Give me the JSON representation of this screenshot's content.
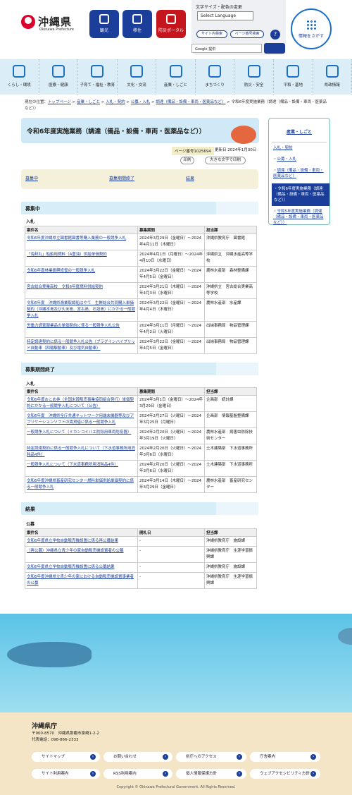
{
  "header": {
    "pref_name": "沖縄県",
    "pref_en": "Okinawa Prefecture",
    "tiles": [
      {
        "label": "観光",
        "color": "#1a3e9a"
      },
      {
        "label": "移住",
        "color": "#1a3e9a"
      },
      {
        "label": "防災ポータル",
        "color": "#c4161c"
      }
    ],
    "text_settings": "文字サイズ・配色の変更",
    "language": "Select Language",
    "site_search": "サイト内検索",
    "page_no_search": "ページ番号検索",
    "help": "?",
    "google": "Google 提供",
    "find": "情報をさがす"
  },
  "nav": [
    "くらし・環境",
    "医療・健康",
    "子育て・福祉・教育",
    "文化・交流",
    "産業・しごと",
    "まちづくり",
    "防災・安全",
    "平和・基地",
    "県政情報"
  ],
  "breadcrumb": {
    "prefix": "現在の位置：",
    "items": [
      "トップページ",
      "産業・しごと",
      "入札・契約",
      "公募・入札",
      "調達（備品・設備・車両・医薬品など）"
    ],
    "current": "令和6年度実施業務（調達（備品・設備・車両・医薬品など））"
  },
  "page": {
    "title": "令和6年度実施業務（調達（備品・設備・車両・医薬品など））",
    "page_no": "ページ番号1025694",
    "updated": "更新日 2024年1月30日",
    "print": "印刷",
    "large_print": "大きな文字で印刷"
  },
  "jump": [
    "募集中",
    "募集期間終了",
    "結果"
  ],
  "sections": {
    "open": {
      "title": "募集中",
      "sub": "入札",
      "headers": [
        "案件名",
        "募集期間",
        "担当課"
      ],
      "rows": [
        [
          "令和6年度沖縄県立図書館図書等購入業務の一般競争入札",
          "2024年3月29日（金曜日）～2024年4月11日（木曜日）",
          "沖縄県教育庁　図書館"
        ],
        [
          "「海邦丸」船舶用燃料（A重油）供給单価契約",
          "2024年4月1日（月曜日）～2024年4月10日（水曜日）",
          "沖縄県立　沖縄水産高等学校"
        ],
        [
          "令和6年度林業振興修復の一般競争入札",
          "2024年3月22日（金曜日）～2024年4月5日（金曜日）",
          "農林水産部　森林整備課"
        ],
        [
          "宮古総合実業高校　令和6年度燃料供給契約",
          "2024年3月21日（木曜日）～2024年4月3日（水曜日）",
          "沖縄県立　宮古総合実業高等学校"
        ],
        [
          "令和6年度　沖縄県漁業取締船はやて　生鮮総合共同購入単価契約（沖縄本島及び久米島、宮古島、石垣島）にかかる一般競争入札",
          "2024年3月22日（金曜日）～2024年4月4日（木曜日）",
          "農林水産部　水産課"
        ],
        [
          "労働力調査報業品の単価契約に係る一般競争入札公告",
          "2024年3月11日（月曜日）～2024年4月2日（火曜日）",
          "出納事務局　物品管理課"
        ],
        [
          "特定調達契約に係る一般競争入札公告（プラグインハイブリッド自動車（四輪駆動車）及び電気自動車）",
          "2024年3月22日（金曜日）～2024年4月5日（金曜日）",
          "出納事務局　物品管理課"
        ]
      ]
    },
    "closed": {
      "title": "募集期間終了",
      "sub": "入札",
      "headers": [
        "案件名",
        "募集期間",
        "担当課"
      ],
      "rows": [
        [
          "令和6年度おこめ券（全国米穀販売事業協同組合発行）単価契約にかかる一般競争入札について（公告）",
          "2024年3月1日（金曜日）～2024年3月29日（金曜日）",
          "企画部　統計課"
        ],
        [
          "令和6年度　沖縄県全庁共通ネットワーク用端末機器等及びアプリケーションソフトの賃貸借に係る一般競争入札",
          "2024年2月27日（火曜日）～2024年3月25日（月曜日）",
          "企画部　情報基盤整備課"
        ],
        [
          "一般競争入札について（ミカンコミバエ防除用車両防疫器）",
          "2024年2月20日（火曜日）～2024年3月19日（火曜日）",
          "農林水産部　病害虫防除技術センター"
        ],
        [
          "特定調達契約に係る一般競争入札について（下水道事務所用消耗品4件）",
          "2024年2月20日（火曜日）～2024年3月6日（水曜日）",
          "土木建築部　下水道事務所"
        ],
        [
          "一般競争入札について（下水道事務所用消耗品4件）",
          "2024年2月20日（火曜日）～2024年3月6日（水曜日）",
          "土木建築部　下水道事務所"
        ],
        [
          "令和6年度沖縄県畜産研究センター燃料単価供給単価契約に係る一般競争入札",
          "2024年3月14日（木曜日）～2024年3月29日（金曜日）",
          "農林水産部　畜産研究センター"
        ]
      ]
    },
    "results": {
      "title": "結果",
      "sub": "公募",
      "headers": [
        "案件名",
        "開札日",
        "担当課"
      ],
      "rows": [
        [
          "令和6年度県立学校自動販売機設置に係る再公募結果",
          "-",
          "沖縄県教育庁　施設課"
        ],
        [
          "（再公募）沖縄県立青少年の家自動販売機設置者の公募",
          "-",
          "沖縄県教育庁　生涯学習振興課"
        ],
        [
          "令和6年度県立学校自動販売機設置に係る公募結果",
          "-",
          "沖縄県教育庁　施設課"
        ],
        [
          "令和6年度沖縄県立青少年の家における自動販売機設置事業者の公募",
          "-",
          "沖縄県教育庁　生涯学習振興課"
        ]
      ]
    }
  },
  "sidebar": {
    "title": "産業・しごと",
    "items": [
      "入札・契約",
      "公募・入札",
      "調達（備品・設備・車両・医薬品など）"
    ],
    "active": "令和6年度実施業務（調達（備品・設備・車両・医薬品など））",
    "last": "令和5年度実施業務（調達（備品・設備・車両・医薬品など））"
  },
  "footer": {
    "name": "沖縄県庁",
    "address": "〒900-8570　沖縄県那覇市泉崎1-2-2",
    "tel": "代表電話：098-866-2333",
    "buttons": [
      "サイトマップ",
      "お問い合わせ",
      "県庁へのアクセス",
      "庁舎案内",
      "サイト利用案内",
      "RSS利用案内",
      "個人情報保護方針",
      "ウェブアクセシビリティ方針"
    ],
    "copyright": "Copyright © Okinawa Prefectural Government. All Rights Reserved."
  }
}
